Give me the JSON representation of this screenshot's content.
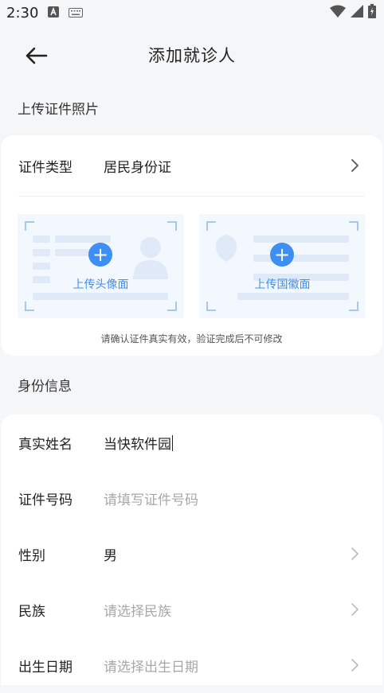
{
  "status_bar": {
    "time": "2:30"
  },
  "header": {
    "title": "添加就诊人"
  },
  "upload_section": {
    "title": "上传证件照片",
    "id_type_label": "证件类型",
    "id_type_value": "居民身份证",
    "front_label": "上传头像面",
    "back_label": "上传国徽面",
    "notice": "请确认证件真实有效，验证完成后不可修改"
  },
  "info_section": {
    "title": "身份信息",
    "fields": [
      {
        "label": "真实姓名",
        "value": "当快软件园",
        "placeholder": ""
      },
      {
        "label": "证件号码",
        "value": "",
        "placeholder": "请填写证件号码"
      },
      {
        "label": "性别",
        "value": "男",
        "placeholder": ""
      },
      {
        "label": "民族",
        "value": "",
        "placeholder": "请选择民族"
      },
      {
        "label": "出生日期",
        "value": "",
        "placeholder": "请选择出生日期"
      }
    ]
  },
  "colors": {
    "accent": "#3d8ef5",
    "background": "#f5f6f8",
    "card": "#ffffff",
    "placeholder": "#a8a8a8"
  }
}
